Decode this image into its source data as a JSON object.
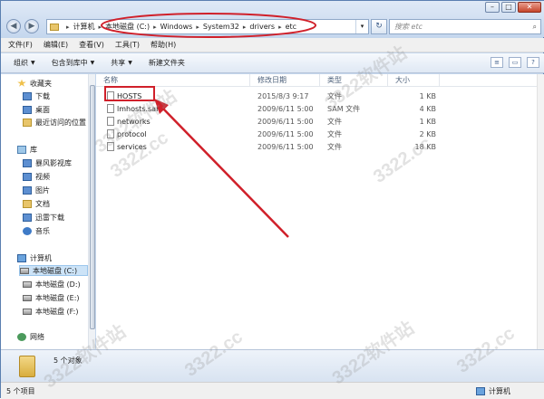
{
  "window": {
    "controls": {
      "minimize": "–",
      "maximize": "□",
      "close": "✕"
    }
  },
  "nav_buttons": {
    "back": "◀",
    "forward": "▶"
  },
  "address": {
    "crumbs": [
      "计算机",
      "本地磁盘 (C:)",
      "Windows",
      "System32",
      "drivers",
      "etc"
    ],
    "separator": "▸",
    "dropdown": "▾"
  },
  "refresh": "↻",
  "search": {
    "placeholder": "搜索 etc",
    "icon": "search-icon"
  },
  "menu": [
    "文件(F)",
    "编辑(E)",
    "查看(V)",
    "工具(T)",
    "帮助(H)"
  ],
  "toolbar": {
    "organize": "组织",
    "include_library": "包含到库中",
    "share": "共享",
    "new_folder": "新建文件夹",
    "caret": "▼"
  },
  "sidebar": {
    "favorites": {
      "label": "收藏夹",
      "items": [
        "下载",
        "桌面",
        "最近访问的位置"
      ]
    },
    "libraries": {
      "label": "库",
      "items": [
        "暴风影视库",
        "视频",
        "图片",
        "文档",
        "迅雷下载",
        "音乐"
      ]
    },
    "computer": {
      "label": "计算机",
      "items": [
        "本地磁盘 (C:)",
        "本地磁盘 (D:)",
        "本地磁盘 (E:)",
        "本地磁盘 (F:)"
      ]
    },
    "network": {
      "label": "网络"
    }
  },
  "columns": {
    "name": "名称",
    "modified": "修改日期",
    "type": "类型",
    "size": "大小"
  },
  "files": [
    {
      "name": "HOSTS",
      "modified": "2015/8/3 9:17",
      "type": "文件",
      "size": "1 KB"
    },
    {
      "name": "lmhosts.sam",
      "modified": "2009/6/11 5:00",
      "type": "SAM 文件",
      "size": "4 KB"
    },
    {
      "name": "networks",
      "modified": "2009/6/11 5:00",
      "type": "文件",
      "size": "1 KB"
    },
    {
      "name": "protocol",
      "modified": "2009/6/11 5:00",
      "type": "文件",
      "size": "2 KB"
    },
    {
      "name": "services",
      "modified": "2009/6/11 5:00",
      "type": "文件",
      "size": "18 KB"
    }
  ],
  "details": {
    "count_text": "5 个对象"
  },
  "status": {
    "left": "5 个项目",
    "right": "计算机"
  },
  "watermark": "3322软件站",
  "watermark_url": "3322.cc",
  "annotation_color": "#d0202a"
}
